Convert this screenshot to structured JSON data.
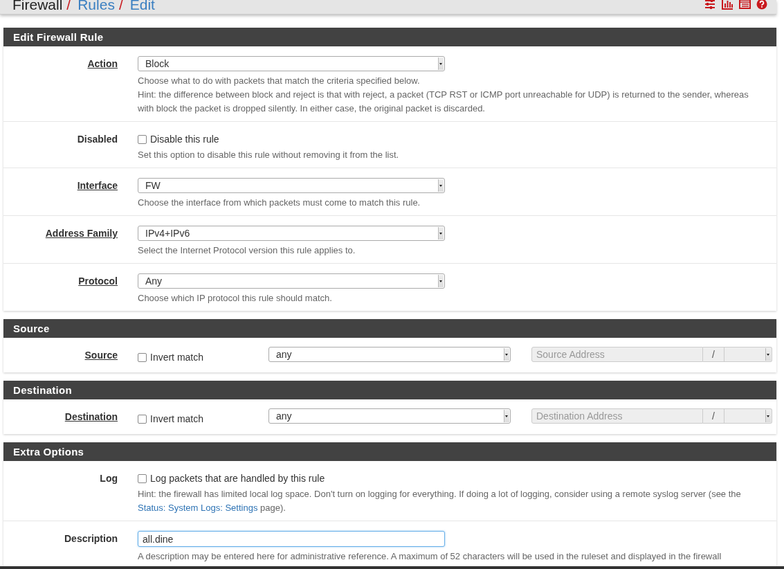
{
  "breadcrumb": [
    {
      "label": "Firewall",
      "link": false,
      "slash": "/"
    },
    {
      "label": "Rules",
      "link": true,
      "slash": "/"
    },
    {
      "label": "Edit",
      "link": true
    }
  ],
  "panels": [
    {
      "title": "Edit Firewall Rule",
      "rows": [
        {
          "kind": "select",
          "label": "Action",
          "label_link": true,
          "value": "Block",
          "help": [
            [
              {
                "text": "Choose what to do with packets that match the criteria specified below."
              }
            ],
            [
              {
                "text": "Hint: the difference between block and reject is that with reject, a packet (TCP RST or ICMP port unreachable for UDP) is returned to the sender, whereas with block the packet is dropped silently. In either case, the original packet is discarded."
              }
            ]
          ]
        },
        {
          "kind": "checkbox",
          "label": "Disabled",
          "label_link": false,
          "checked": false,
          "caption": "Disable this rule",
          "help": [
            [
              {
                "text": "Set this option to disable this rule without removing it from the list."
              }
            ]
          ]
        },
        {
          "kind": "select",
          "label": "Interface",
          "label_link": true,
          "value": "FW",
          "help": [
            [
              {
                "text": "Choose the interface from which packets must come to match this rule."
              }
            ]
          ]
        },
        {
          "kind": "select",
          "label": "Address Family",
          "label_link": true,
          "value": "IPv4+IPv6",
          "help": [
            [
              {
                "text": "Select the Internet Protocol version this rule applies to."
              }
            ]
          ]
        },
        {
          "kind": "select",
          "label": "Protocol",
          "label_link": true,
          "value": "Any",
          "help": [
            [
              {
                "text": "Choose which IP protocol this rule should match."
              }
            ]
          ]
        }
      ]
    },
    {
      "title": "Source",
      "rows": [
        {
          "kind": "address",
          "label": "Source",
          "label_link": true,
          "checked": false,
          "caption": "Invert match",
          "value": "any",
          "placeholder": "Source Address",
          "separator": "/"
        }
      ]
    },
    {
      "title": "Destination",
      "rows": [
        {
          "kind": "address",
          "label": "Destination",
          "label_link": true,
          "checked": false,
          "caption": "Invert match",
          "value": "any",
          "placeholder": "Destination Address",
          "separator": "/"
        }
      ]
    },
    {
      "title": "Extra Options",
      "rows": [
        {
          "kind": "checkbox",
          "label": "Log",
          "label_link": false,
          "checked": false,
          "caption": "Log packets that are handled by this rule",
          "help": [
            [
              {
                "text": "Hint: the firewall has limited local log space. Don't turn on logging for everything. If doing a lot of logging, consider using a remote syslog server (see the "
              },
              {
                "text": "Status: System Logs: Settings",
                "link": true
              },
              {
                "text": " page)."
              }
            ]
          ]
        },
        {
          "kind": "text",
          "label": "Description",
          "label_link": false,
          "value": "all.dine",
          "help": [
            [
              {
                "text": "A description may be entered here for administrative reference. A maximum of 52 characters will be used in the ruleset and displayed in the firewall"
              }
            ]
          ]
        }
      ]
    }
  ]
}
